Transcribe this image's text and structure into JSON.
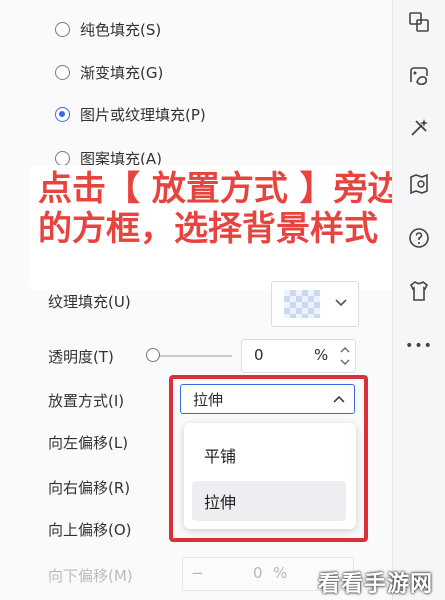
{
  "fill_options": [
    {
      "label": "纯色填充(S)",
      "selected": false
    },
    {
      "label": "渐变填充(G)",
      "selected": false
    },
    {
      "label": "图片或纹理填充(P)",
      "selected": true
    },
    {
      "label": "图案填充(A)",
      "selected": false
    }
  ],
  "annotation": "点击【 放置方式 】旁边的方框，选择背景样式",
  "texture": {
    "label": "纹理填充(U)"
  },
  "transparency": {
    "label": "透明度(T)",
    "value": "0",
    "unit": "%",
    "level": 0
  },
  "placement": {
    "label": "放置方式(I)",
    "value": "拉伸",
    "options": [
      "平铺",
      "拉伸"
    ],
    "highlighted": "拉伸"
  },
  "offsets": {
    "left": "向左偏移(L)",
    "right": "向右偏移(R)",
    "up": "向上偏移(O)",
    "down": "向下偏移(M)",
    "down_value": "0",
    "down_unit": "%",
    "down_minus": "−"
  },
  "sidebar_icons": [
    "swap-icon",
    "paint-fill-icon",
    "magic-tools-icon",
    "map-guide-icon",
    "help-icon",
    "shirt-icon",
    "more-icon"
  ],
  "sidebar_more": "•••",
  "watermark": "看看手游网",
  "colors": {
    "accent": "#3b68e6",
    "annotation_red": "#e8443f",
    "highlight_border": "#d9303a"
  }
}
